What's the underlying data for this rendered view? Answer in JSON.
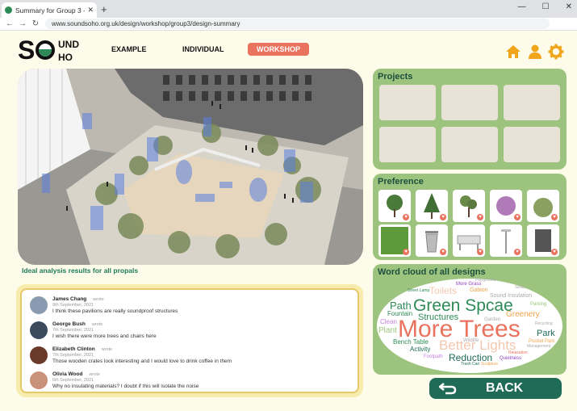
{
  "browser": {
    "tab_title": "Summary for Group 3 - S...",
    "url": "www.soundsoho.org.uk/design/workshop/group3/design-summary",
    "tab_close": "✕",
    "new_tab": "+",
    "minimize": "—",
    "maximize": "☐",
    "close": "✕"
  },
  "header": {
    "logo_s": "S",
    "logo_und": "UND",
    "logo_ho": "HO",
    "nav": [
      {
        "label": "EXAMPLE"
      },
      {
        "label": "INDIVIDUAL"
      },
      {
        "label": "WORKSHOP"
      }
    ]
  },
  "main": {
    "caption": "Ideal analysis results for all propals"
  },
  "comments": [
    {
      "name": "James Chang",
      "wrote": "wrote",
      "date": "9th September, 2021",
      "text": "I think these pavilions are really soundproof structures"
    },
    {
      "name": "George Bush",
      "wrote": "wrote",
      "date": "7th September, 2021",
      "text": "I wish there were more trees and chairs here"
    },
    {
      "name": "Elizabeth Clinton",
      "wrote": "wrote",
      "date": "7th September, 2021",
      "text": "Those wooden crates look interesting and I would love to drink coffee in them"
    },
    {
      "name": "Olivia Wood",
      "wrote": "wrote",
      "date": "6th September, 2021",
      "text": "Why no insulating materials? I doubt if this will isolate the noise"
    }
  ],
  "panels": {
    "projects_title": "Projects",
    "preference_title": "Preference",
    "wordcloud_title": "Word cloud of all designs"
  },
  "wordcloud": [
    {
      "text": "More Trees",
      "color": "#e9735f"
    },
    {
      "text": "Green Spcae",
      "color": "#2e8b57"
    },
    {
      "text": "Better Lights",
      "color": "#f4c7b0"
    },
    {
      "text": "Toilets",
      "color": "#f4c7b0"
    },
    {
      "text": "Path",
      "color": "#2e8b57"
    },
    {
      "text": "Structures",
      "color": "#2e8b57"
    },
    {
      "text": "Reduction",
      "color": "#1f6b57"
    },
    {
      "text": "Park",
      "color": "#1f6b57"
    },
    {
      "text": "Greenery",
      "color": "#f0a24a"
    },
    {
      "text": "Fountain",
      "color": "#2e8b57"
    },
    {
      "text": "Gabion",
      "color": "#f0a24a"
    },
    {
      "text": "Plant",
      "color": "#9dc47e"
    },
    {
      "text": "Clean",
      "color": "#c880e0"
    },
    {
      "text": "Activity",
      "color": "#1f6b57"
    },
    {
      "text": "Bench Table",
      "color": "#2e8b57"
    },
    {
      "text": "More Grass",
      "color": "#9040c0"
    },
    {
      "text": "Sound Insulation",
      "color": "#aaaaaa"
    },
    {
      "text": "Parking",
      "color": "#9dc47e"
    },
    {
      "text": "Recycling",
      "color": "#aaaaaa"
    },
    {
      "text": "Pocket Park",
      "color": "#f0a24a"
    },
    {
      "text": "Management",
      "color": "#aaaaaa"
    },
    {
      "text": "Garden",
      "color": "#aaaaaa"
    },
    {
      "text": "Wildlife",
      "color": "#aaaaaa"
    },
    {
      "text": "Footpath",
      "color": "#c880e0"
    },
    {
      "text": "Quietness",
      "color": "#9040c0"
    },
    {
      "text": "Relaxation",
      "color": "#e9735f"
    },
    {
      "text": "Sculpture",
      "color": "#f0a24a"
    },
    {
      "text": "Trash Can",
      "color": "#1f6b57"
    },
    {
      "text": "Street Lamp",
      "color": "#2e8b57"
    },
    {
      "text": "Playground",
      "color": "#aaaaaa"
    },
    {
      "text": "Seats",
      "color": "#aaaaaa"
    }
  ],
  "back": {
    "label": "BACK"
  },
  "colors": {
    "accent": "#e9735f",
    "panel": "#9dc47e",
    "dark_green": "#1f6b57",
    "page_bg": "#fdfbe9"
  }
}
